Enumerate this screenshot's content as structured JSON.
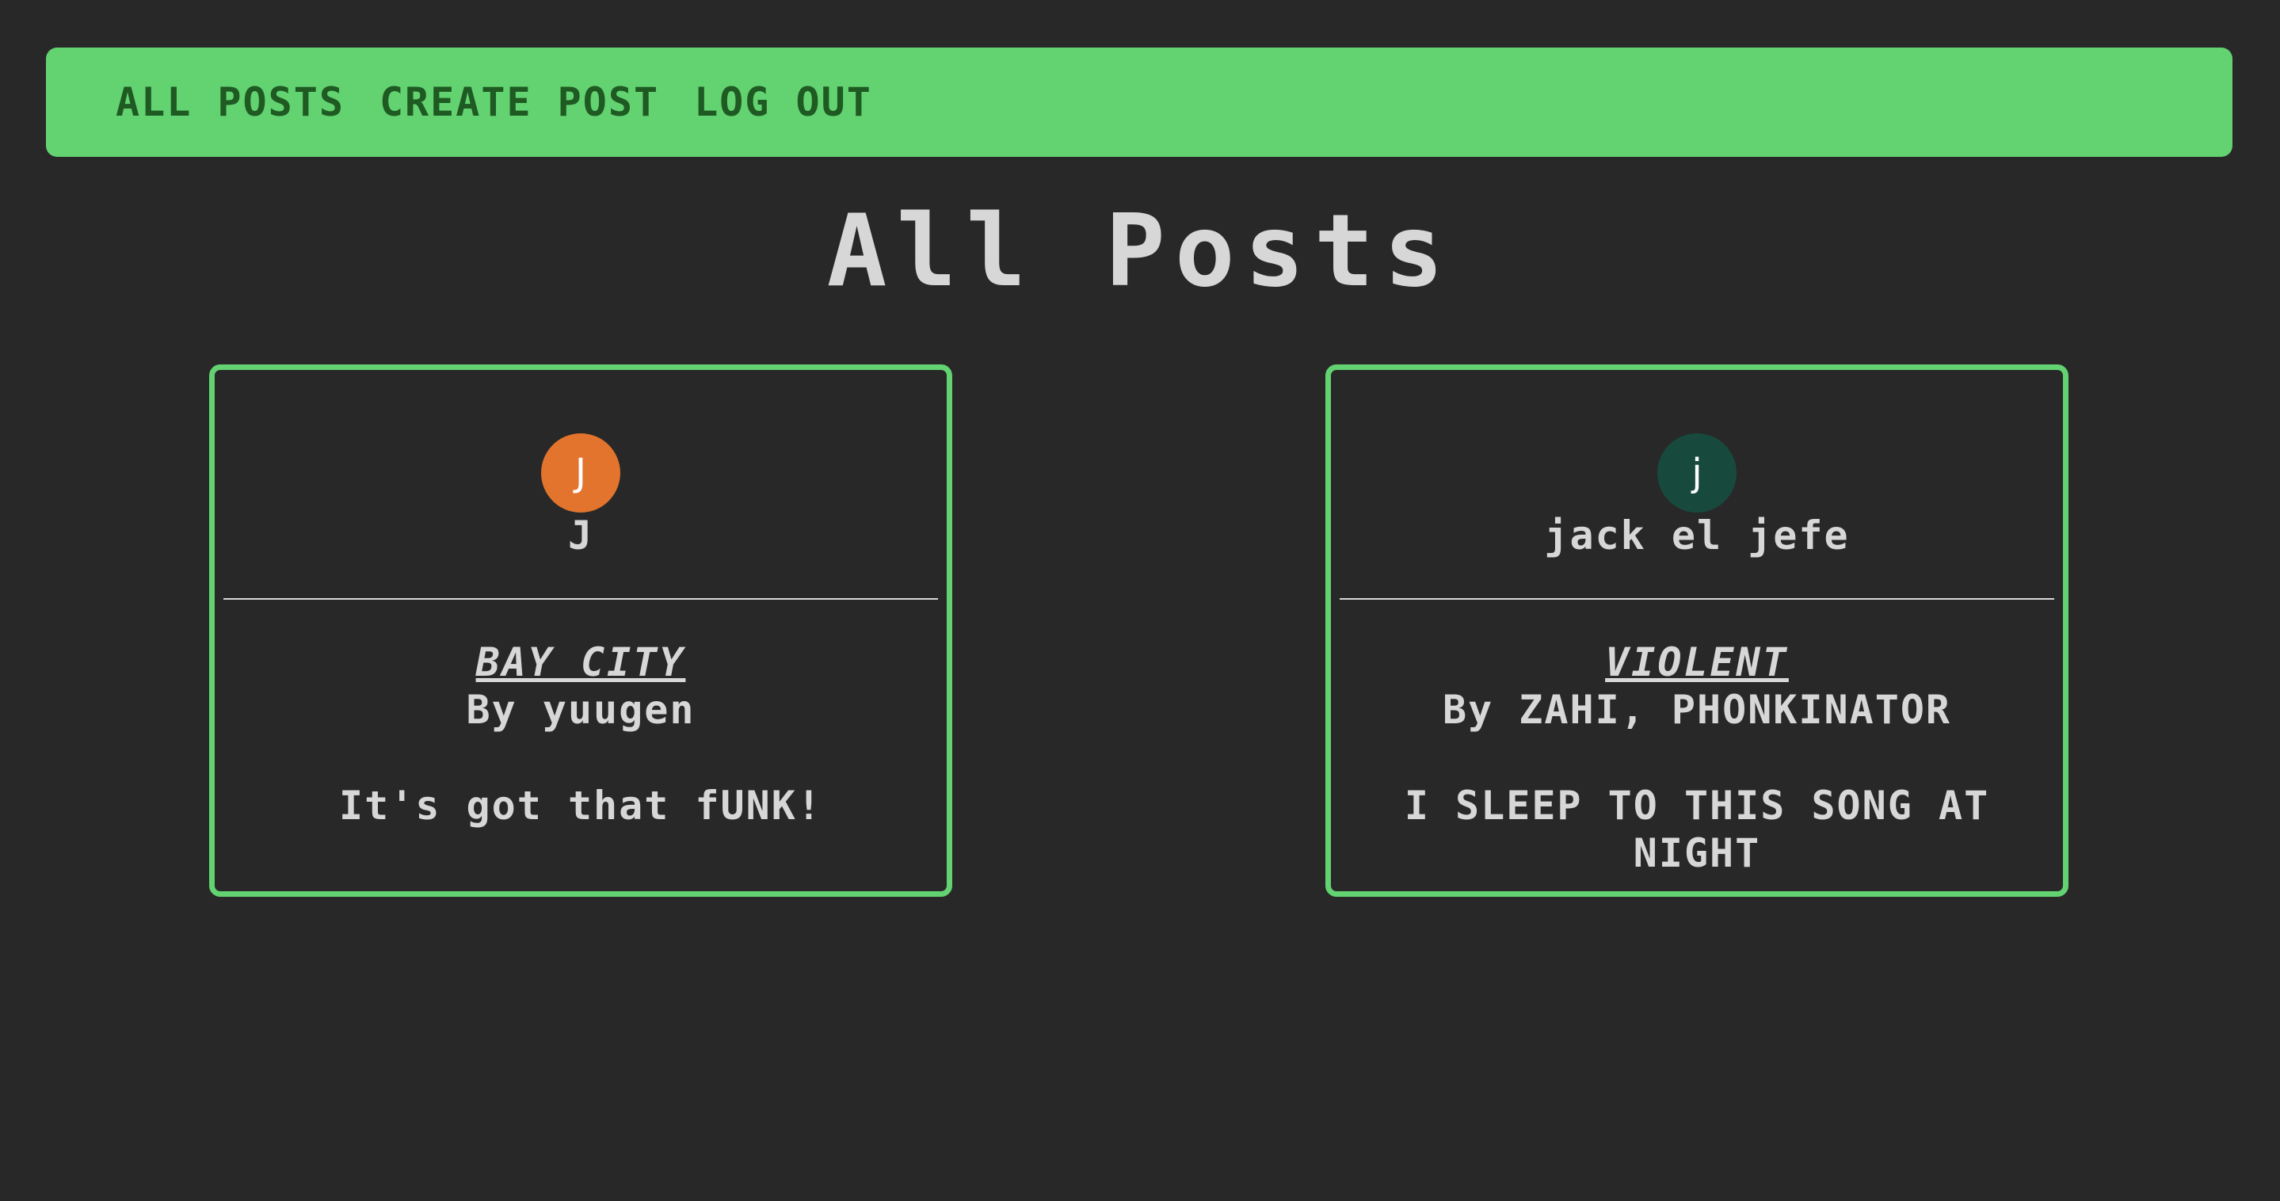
{
  "nav": {
    "all_posts": "ALL POSTS",
    "create_post": "CREATE POST",
    "log_out": "LOG OUT"
  },
  "page": {
    "title": "All Posts"
  },
  "posts": [
    {
      "avatar_letter": "J",
      "avatar_color": "#e2742d",
      "author": "J",
      "song_title": "BAY CITY",
      "artist": "By yuugen",
      "caption": "It's got that fUNK!"
    },
    {
      "avatar_letter": "j",
      "avatar_color": "#174a3d",
      "author": "jack el jefe",
      "song_title": "VIOLENT",
      "artist": "By ZAHI, PHONKINATOR",
      "caption": "I SLEEP TO THIS SONG AT NIGHT"
    }
  ],
  "colors": {
    "background": "#282828",
    "accent": "#63d271",
    "text": "#d7d7d7",
    "nav_text": "#1e5a22"
  }
}
